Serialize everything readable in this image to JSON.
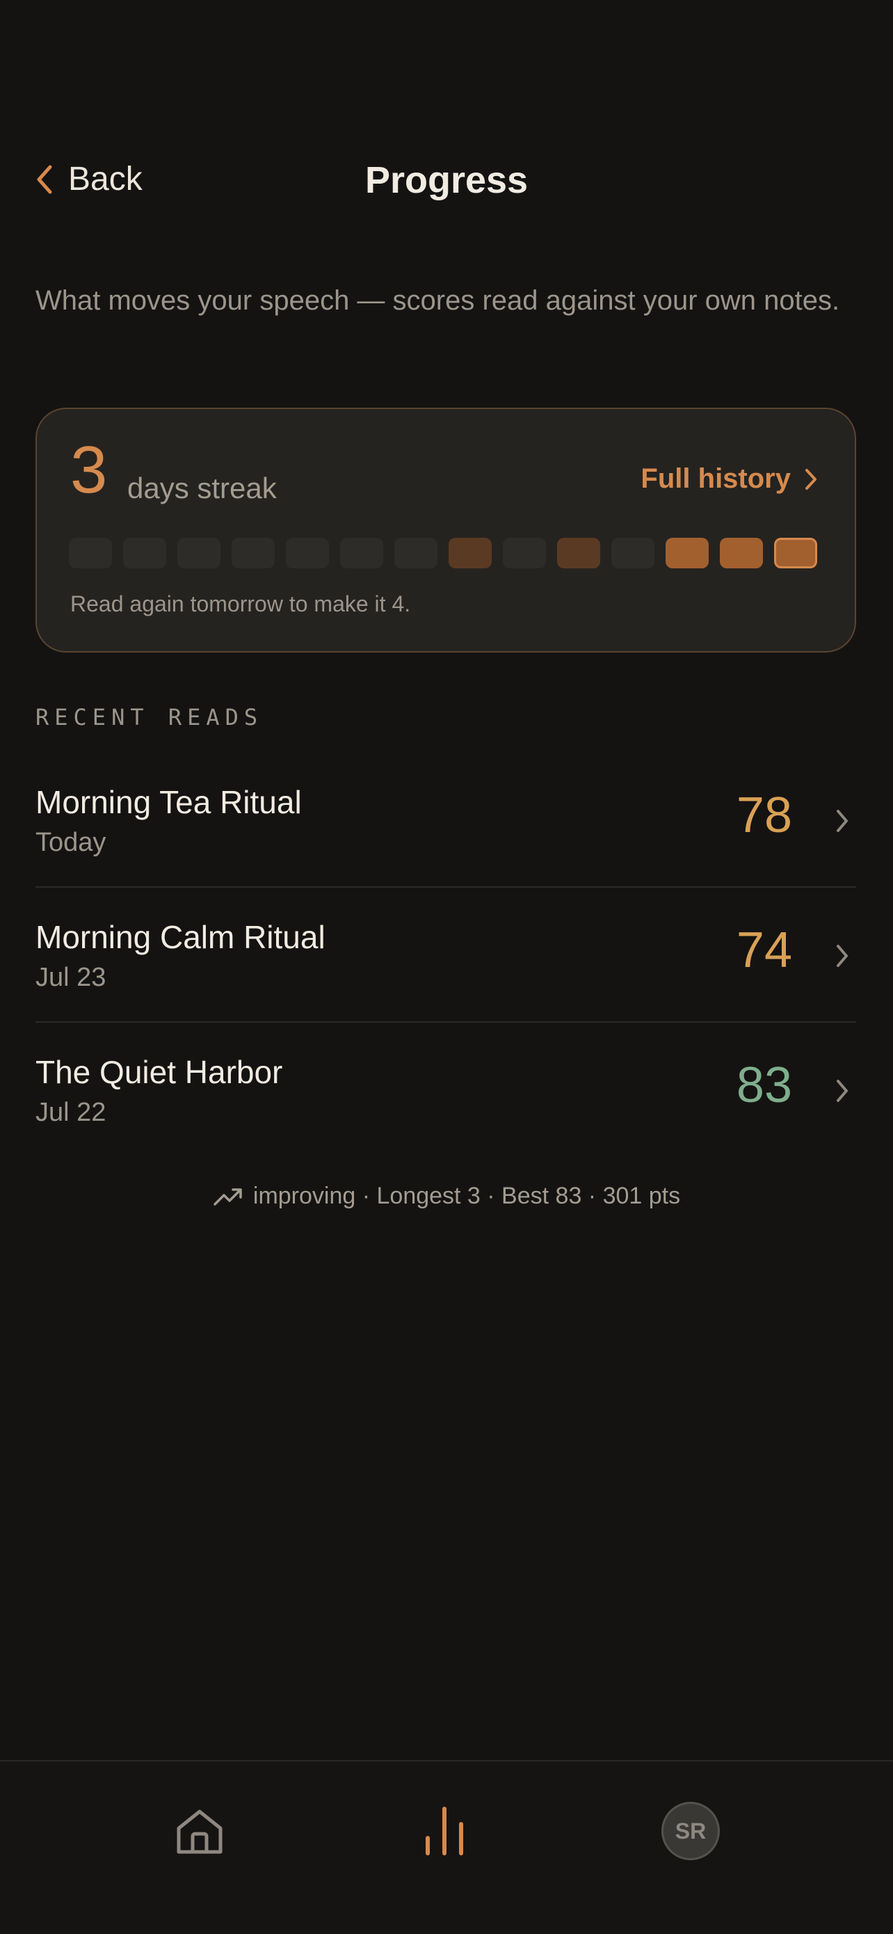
{
  "header": {
    "back_label": "Back",
    "title": "Progress"
  },
  "subtitle": "What moves your speech — scores read against your own notes.",
  "streak": {
    "count": "3",
    "label": "days streak",
    "full_history_label": "Full history",
    "days": [
      "none",
      "none",
      "none",
      "none",
      "none",
      "none",
      "none",
      "low",
      "none",
      "low",
      "none",
      "high",
      "high",
      "today"
    ],
    "hint": "Read again tomorrow to make it 4."
  },
  "recent": {
    "label": "RECENT READS",
    "items": [
      {
        "title": "Morning Tea Ritual",
        "date": "Today",
        "score": "78",
        "score_color": "#D9A155"
      },
      {
        "title": "Morning Calm Ritual",
        "date": "Jul 23",
        "score": "74",
        "score_color": "#D9A155"
      },
      {
        "title": "The Quiet Harbor",
        "date": "Jul 22",
        "score": "83",
        "score_color": "#7FAE8C"
      }
    ]
  },
  "summary": {
    "icon": "trending-up-icon",
    "text": "improving · Longest 3 · Best 83 · 301 pts"
  },
  "tabbar": {
    "home_icon": "home-icon",
    "progress_icon": "bar-chart-icon",
    "avatar_initials": "SR",
    "active_tab": "progress",
    "accent": "#D68A4E"
  }
}
